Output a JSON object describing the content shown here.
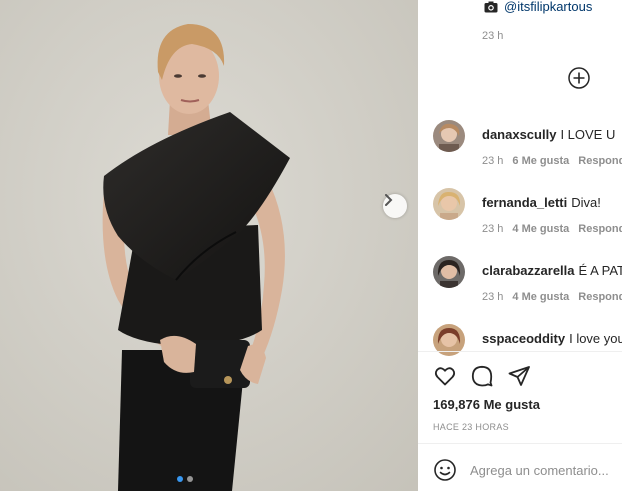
{
  "post": {
    "photo_credit": "@itsfilipkartous",
    "credit_time": "23 h",
    "comments": [
      {
        "username": "danaxscully",
        "text": "I LOVE U",
        "time": "23 h",
        "likes": "6 Me gusta",
        "reply": "Responder"
      },
      {
        "username": "fernanda_letti",
        "text": "Diva!",
        "time": "23 h",
        "likes": "4 Me gusta",
        "reply": "Responder"
      },
      {
        "username": "clarabazzarella",
        "text": "É A PATROA",
        "time": "23 h",
        "likes": "4 Me gusta",
        "reply": "Responder"
      },
      {
        "username": "sspaceoddity",
        "text": "I love you"
      }
    ],
    "likes_count": "169,876 Me gusta",
    "posted_ago": "HACE 23 HORAS",
    "comment_placeholder": "Agrega un comentario...",
    "carousel": {
      "current": 1,
      "total": 2
    }
  },
  "icons": {
    "camera": "camera-icon",
    "add_comment": "plus-circle-icon",
    "like": "heart-icon",
    "comment": "comment-bubble-icon",
    "share": "paper-plane-icon",
    "emoji": "smiley-icon",
    "next": "chevron-right-icon"
  },
  "colors": {
    "accent": "#3897f0",
    "username_link": "#00376b",
    "muted_text": "#8e8e8e",
    "text": "#262626",
    "photo_background": "#d2d0c8"
  }
}
